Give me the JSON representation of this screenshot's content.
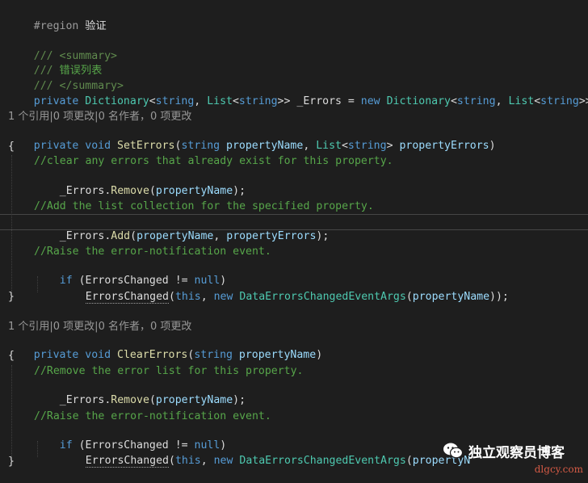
{
  "code": {
    "region": {
      "directive": "#region",
      "label": "验证"
    },
    "doc": {
      "open_prefix": "/// ",
      "open_tag": "<summary>",
      "text_prefix": "/// ",
      "text": "错误列表",
      "close_prefix": "/// ",
      "close_tag": "</summary>"
    },
    "field": {
      "mod": "private",
      "type1": "Dictionary",
      "p1": "<",
      "kw1": "string",
      "p2": ", ",
      "type2": "List",
      "p3": "<",
      "kw2": "string",
      "p4": ">> ",
      "name": "_Errors",
      "p5": " = ",
      "kw_new": "new",
      "type3": "Dictionary",
      "p6": "<",
      "kw3": "string",
      "p7": ", ",
      "type4": "List",
      "p8": "<",
      "kw4": "string",
      "p9": ">>();"
    },
    "lens1": "1 个引用|0 项更改|0 名作者，0 项更改",
    "set_errors": {
      "mod": "private",
      "ret": "void",
      "name": "SetErrors",
      "p1": "(",
      "kw1": "string",
      "param1": "propertyName",
      "p2": ", ",
      "type1": "List",
      "p3": "<",
      "kw2": "string",
      "p4": "> ",
      "param2": "propertyErrors",
      "p5": ")",
      "open_brace": "{",
      "c1": "//clear any errors that already exist for this property.",
      "remove": {
        "obj": "_Errors.",
        "method": "Remove",
        "p1": "(",
        "arg": "propertyName",
        "p2": ");"
      },
      "c2": "//Add the list collection for the specified property.",
      "add": {
        "obj": "_Errors.",
        "method": "Add",
        "p1": "(",
        "arg1": "propertyName",
        "p2": ", ",
        "arg2": "propertyErrors",
        "p3": ");"
      },
      "c3": "//Raise the error-notification event.",
      "if_line": {
        "kw": "if",
        "p1": " (ErrorsChanged != ",
        "kw_null": "null",
        "p2": ")"
      },
      "invoke": {
        "name": "ErrorsChanged",
        "p1": "(",
        "kw_this": "this",
        "p2": ", ",
        "kw_new": "new",
        "sp": " ",
        "type": "DataErrorsChangedEventArgs",
        "p3": "(",
        "arg": "propertyName",
        "p4": "));"
      },
      "close_brace": "}"
    },
    "lens2": "1 个引用|0 项更改|0 名作者，0 项更改",
    "clear_errors": {
      "mod": "private",
      "ret": "void",
      "name": "ClearErrors",
      "p1": "(",
      "kw1": "string",
      "param1": "propertyName",
      "p2": ")",
      "open_brace": "{",
      "c1": "//Remove the error list for this property.",
      "remove": {
        "obj": "_Errors.",
        "method": "Remove",
        "p1": "(",
        "arg": "propertyName",
        "p2": ");"
      },
      "c2": "//Raise the error-notification event.",
      "if_line": {
        "kw": "if",
        "p1": " (ErrorsChanged != ",
        "kw_null": "null",
        "p2": ")"
      },
      "invoke": {
        "name": "ErrorsChanged",
        "p1": "(",
        "kw_this": "this",
        "p2": ", ",
        "kw_new": "new",
        "sp": " ",
        "type": "DataErrorsChangedEventArgs",
        "p3": "(",
        "arg": "propertyN"
      },
      "close_brace": "}"
    }
  },
  "watermark": {
    "label": "独立观察员博客",
    "url": "dlgcy.com",
    "icon": "wechat-icon"
  },
  "colors": {
    "background": "#1e1e1e",
    "keyword": "#569cd6",
    "type": "#4ec9b0",
    "method": "#dcdcaa",
    "parameter": "#9cdcfe",
    "comment": "#57a64a"
  }
}
